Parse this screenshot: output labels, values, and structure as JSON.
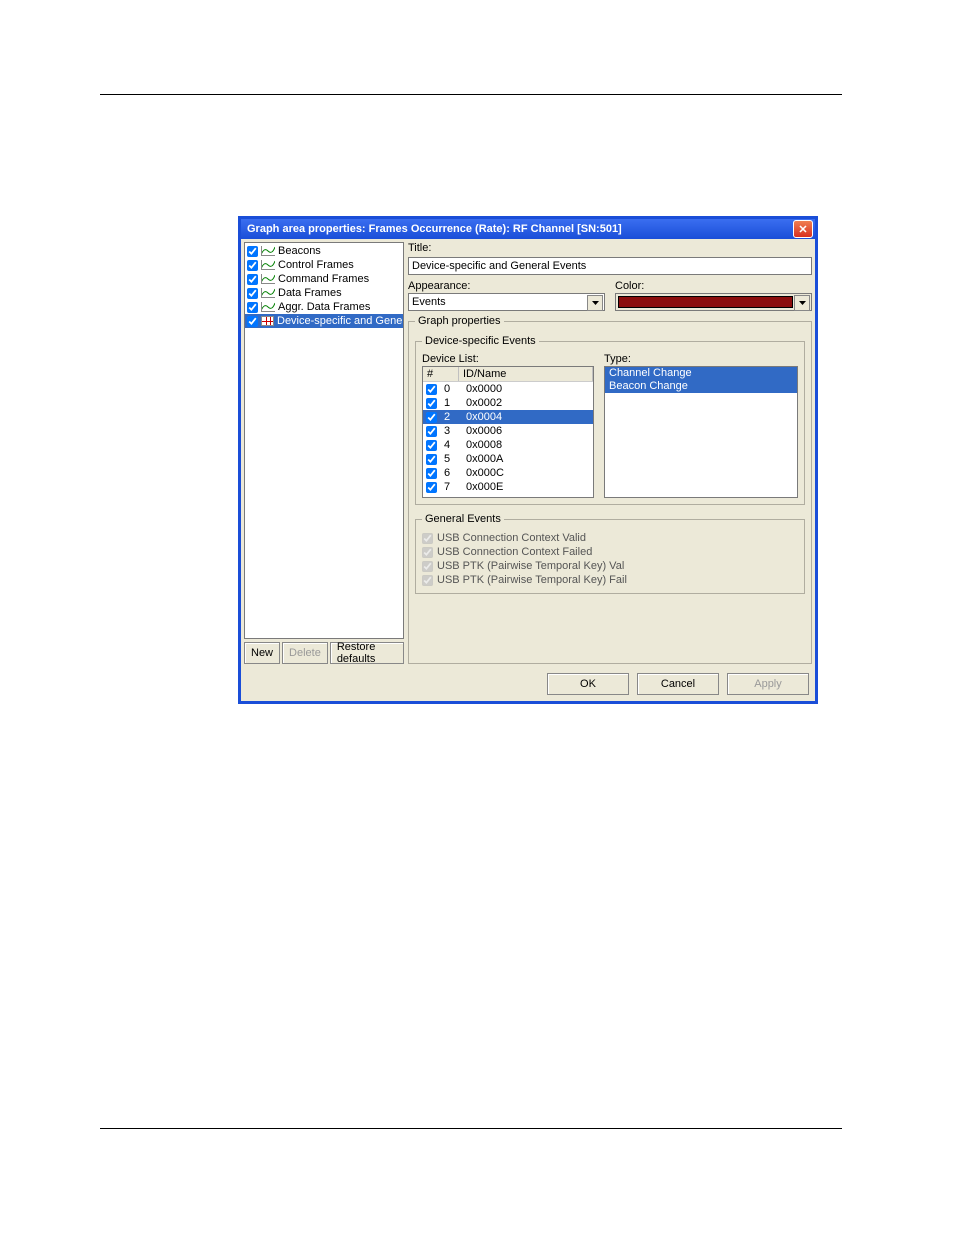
{
  "window": {
    "title": "Graph area properties: Frames Occurrence (Rate): RF Channel [SN:501]"
  },
  "tree": {
    "items": [
      {
        "label": "Beacons",
        "checked": true,
        "icon": "curve",
        "sel": false
      },
      {
        "label": "Control Frames",
        "checked": true,
        "icon": "curve",
        "sel": false
      },
      {
        "label": "Command  Frames",
        "checked": true,
        "icon": "curve",
        "sel": false
      },
      {
        "label": "Data Frames",
        "checked": true,
        "icon": "curve",
        "sel": false
      },
      {
        "label": "Aggr. Data Frames",
        "checked": true,
        "icon": "curve",
        "sel": false
      },
      {
        "label": "Device-specific and General Even",
        "checked": true,
        "icon": "grid",
        "sel": true
      }
    ]
  },
  "left_buttons": {
    "new": "New",
    "delete": "Delete",
    "restore": "Restore defaults"
  },
  "form": {
    "title_label": "Title:",
    "title_value": "Device-specific and General Events",
    "appearance_label": "Appearance:",
    "appearance_value": "Events",
    "color_label": "Color:",
    "color_value": "#8b0d0d"
  },
  "fieldsets": {
    "graph_props": "Graph properties",
    "device_specific": "Device-specific Events",
    "general_events": "General Events"
  },
  "device_list": {
    "label": "Device List:",
    "headers": {
      "num": "#",
      "idname": "ID/Name"
    },
    "rows": [
      {
        "chk": true,
        "num": "0",
        "id": "0x0000",
        "sel": false
      },
      {
        "chk": true,
        "num": "1",
        "id": "0x0002",
        "sel": false
      },
      {
        "chk": true,
        "num": "2",
        "id": "0x0004",
        "sel": true
      },
      {
        "chk": true,
        "num": "3",
        "id": "0x0006",
        "sel": false
      },
      {
        "chk": true,
        "num": "4",
        "id": "0x0008",
        "sel": false
      },
      {
        "chk": true,
        "num": "5",
        "id": "0x000A",
        "sel": false
      },
      {
        "chk": true,
        "num": "6",
        "id": "0x000C",
        "sel": false
      },
      {
        "chk": true,
        "num": "7",
        "id": "0x000E",
        "sel": false
      }
    ]
  },
  "type_list": {
    "label": "Type:",
    "rows": [
      "Channel Change",
      "Beacon Change"
    ]
  },
  "general_events": {
    "items": [
      {
        "chk": true,
        "label": "USB Connection Context Valid"
      },
      {
        "chk": true,
        "label": "USB Connection Context Failed"
      },
      {
        "chk": true,
        "label": "USB PTK (Pairwise Temporal Key) Val"
      },
      {
        "chk": true,
        "label": "USB PTK (Pairwise Temporal Key) Fail"
      }
    ]
  },
  "footer": {
    "ok": "OK",
    "cancel": "Cancel",
    "apply": "Apply"
  }
}
